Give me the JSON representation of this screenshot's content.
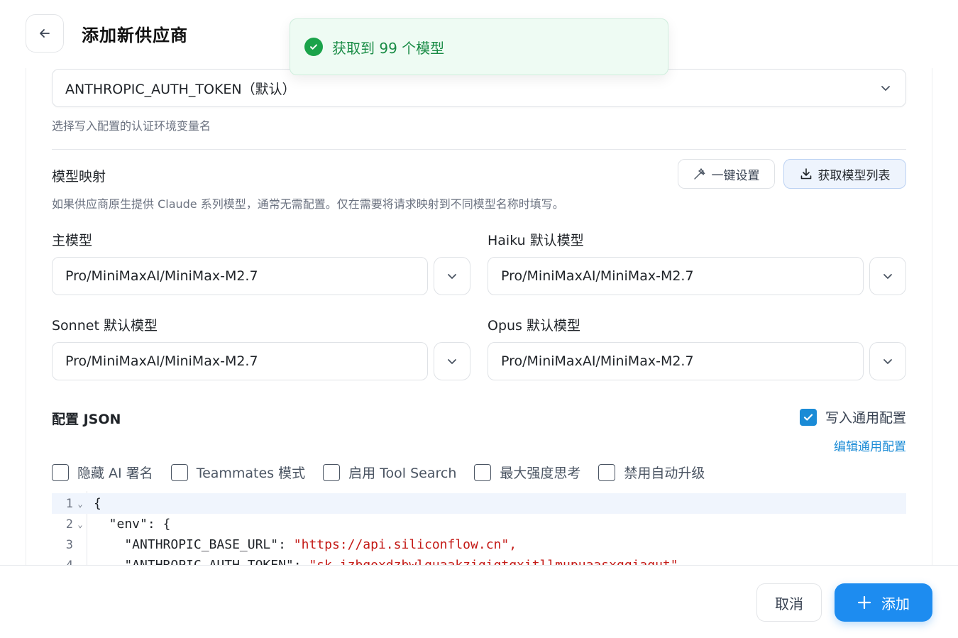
{
  "header": {
    "title": "添加新供应商"
  },
  "toast": {
    "message": "获取到 99 个模型",
    "status_color": "#1aa34a"
  },
  "auth": {
    "selected": "ANTHROPIC_AUTH_TOKEN（默认）",
    "hint": "选择写入配置的认证环境变量名"
  },
  "mapping": {
    "title": "模型映射",
    "desc": "如果供应商原生提供 Claude 系列模型，通常无需配置。仅在需要将请求映射到不同模型名称时填写。",
    "one_click_label": "一键设置",
    "fetch_label": "获取模型列表",
    "fields": [
      {
        "label": "主模型",
        "value": "Pro/MiniMaxAI/MiniMax-M2.7"
      },
      {
        "label": "Haiku 默认模型",
        "value": "Pro/MiniMaxAI/MiniMax-M2.7"
      },
      {
        "label": "Sonnet 默认模型",
        "value": "Pro/MiniMaxAI/MiniMax-M2.7"
      },
      {
        "label": "Opus 默认模型",
        "value": "Pro/MiniMaxAI/MiniMax-M2.7"
      }
    ]
  },
  "config": {
    "title": "配置 JSON",
    "write_common_label": "写入通用配置",
    "write_common_checked": true,
    "edit_common_label": "编辑通用配置",
    "options": [
      {
        "label": "隐藏 AI 署名",
        "checked": false
      },
      {
        "label": "Teammates 模式",
        "checked": false
      },
      {
        "label": "启用 Tool Search",
        "checked": false
      },
      {
        "label": "最大强度思考",
        "checked": false
      },
      {
        "label": "禁用自动升级",
        "checked": false
      }
    ]
  },
  "editor": {
    "lines": [
      {
        "n": "1",
        "fold": "⌄",
        "key": "{",
        "value": ""
      },
      {
        "n": "2",
        "fold": "⌄",
        "key": "  \"env\": {",
        "value": ""
      },
      {
        "n": "3",
        "fold": "",
        "key": "    \"ANTHROPIC_BASE_URL\": ",
        "value": "\"https://api.siliconflow.cn\","
      },
      {
        "n": "4",
        "fold": "",
        "key": "    \"ANTHROPIC_AUTH_TOKEN\": ",
        "value": "\"sk-izbqoxdzbwlquaakziqiqtqxitllmupuaasxqqiaqut\","
      }
    ]
  },
  "footer": {
    "cancel_label": "取消",
    "add_label": "添加"
  },
  "colors": {
    "accent": "#1d8cf0",
    "link": "#1a8bd6",
    "success": "#1aa34a"
  }
}
